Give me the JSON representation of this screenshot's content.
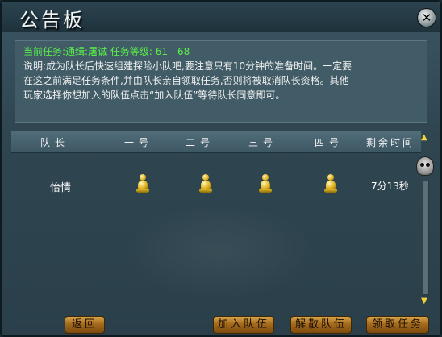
{
  "window": {
    "title": "公告板"
  },
  "info": {
    "task_label": "当前任务:",
    "task_name": "通缉:屠诚",
    "level_label": "任务等级:",
    "level_range": "61 - 68",
    "desc_lines": [
      "说明:成为队长后快速组建探险小队吧,要注意只有10分钟的准备时间。一定要",
      "在这之前满足任务条件,并由队长亲自领取任务,否则将被取消队长资格。其他",
      "玩家选择你想加入的队伍点击“加入队伍”等待队长同意即可。"
    ]
  },
  "table": {
    "headers": [
      "队长",
      "一号",
      "二号",
      "三号",
      "四号",
      "剩余时间"
    ],
    "rows": [
      {
        "leader": "怡情",
        "remaining_time": "7分13秒"
      }
    ]
  },
  "buttons": {
    "back": "返回",
    "join": "加入队伍",
    "disband": "解散队伍",
    "accept": "领取任务"
  },
  "icons": {
    "close": "close-icon",
    "scroll_up": "arrow-up-icon",
    "scroll_down": "arrow-down-icon",
    "skull": "skull-icon",
    "pawn": "pawn-icon"
  },
  "colors": {
    "accent_green": "#59f04a",
    "button_gold": "#c48a34",
    "panel_blue": "#425c67"
  }
}
